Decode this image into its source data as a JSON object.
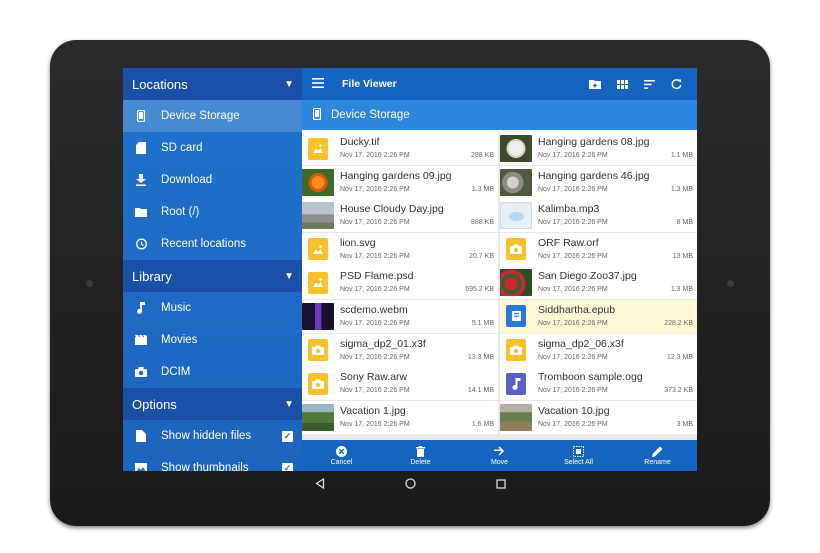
{
  "sidebar": {
    "sections": {
      "locations": "Locations",
      "library": "Library",
      "options": "Options"
    },
    "locations": [
      {
        "label": "Device Storage",
        "icon": "phone-icon"
      },
      {
        "label": "SD card",
        "icon": "sd-card-icon"
      },
      {
        "label": "Download",
        "icon": "download-icon"
      },
      {
        "label": "Root (/)",
        "icon": "folder-icon"
      },
      {
        "label": "Recent locations",
        "icon": "history-icon"
      }
    ],
    "library": [
      {
        "label": "Music",
        "icon": "music-note-icon"
      },
      {
        "label": "Movies",
        "icon": "movie-icon"
      },
      {
        "label": "DCIM",
        "icon": "camera-icon"
      }
    ],
    "options": [
      {
        "label": "Show hidden files",
        "checked": true
      },
      {
        "label": "Show thumbnails",
        "checked": true
      }
    ]
  },
  "topbar": {
    "title": "File Viewer"
  },
  "path": {
    "label": "Device Storage"
  },
  "files_left": [
    {
      "name": "Ducky.tif",
      "date": "Nov 17, 2016 2:26 PM",
      "size": "288 KB",
      "thumb": "image-icon"
    },
    {
      "name": "Hanging gardens 09.jpg",
      "date": "Nov 17, 2016 2:26 PM",
      "size": "1.3 MB",
      "thumb": "photo-flower-orange"
    },
    {
      "name": "House Cloudy Day.jpg",
      "date": "Nov 17, 2016 2:26 PM",
      "size": "888 KB",
      "thumb": "photo-house"
    },
    {
      "name": "lion.svg",
      "date": "Nov 17, 2016 2:26 PM",
      "size": "20.7 KB",
      "thumb": "image-icon"
    },
    {
      "name": "PSD Flame.psd",
      "date": "Nov 17, 2016 2:26 PM",
      "size": "695.2 KB",
      "thumb": "image-icon"
    },
    {
      "name": "scdemo.webm",
      "date": "Nov 17, 2016 2:26 PM",
      "size": "5.1 MB",
      "thumb": "video-thumb"
    },
    {
      "name": "sigma_dp2_01.x3f",
      "date": "Nov 17, 2016 2:26 PM",
      "size": "13.3 MB",
      "thumb": "camera-file-icon"
    },
    {
      "name": "Sony Raw.arw",
      "date": "Nov 17, 2016 2:26 PM",
      "size": "14.1 MB",
      "thumb": "camera-file-icon"
    },
    {
      "name": "Vacation 1.jpg",
      "date": "Nov 17, 2016 2:26 PM",
      "size": "1.6 MB",
      "thumb": "photo-vacation"
    }
  ],
  "files_right": [
    {
      "name": "Hanging gardens 08.jpg",
      "date": "Nov 17, 2016 2:26 PM",
      "size": "1.1 MB",
      "thumb": "photo-flower-white"
    },
    {
      "name": "Hanging gardens 46.jpg",
      "date": "Nov 17, 2016 2:26 PM",
      "size": "1.3 MB",
      "thumb": "photo-garden"
    },
    {
      "name": "Kalimba.mp3",
      "date": "Nov 17, 2016 2:26 PM",
      "size": "8 MB",
      "thumb": "album-art"
    },
    {
      "name": "ORF Raw.orf",
      "date": "Nov 17, 2016 2:26 PM",
      "size": "13 MB",
      "thumb": "camera-file-icon"
    },
    {
      "name": "San Diego Zoo37.jpg",
      "date": "Nov 17, 2016 2:26 PM",
      "size": "1.3 MB",
      "thumb": "photo-red-flower"
    },
    {
      "name": "Siddhartha.epub",
      "date": "Nov 17, 2016 2:26 PM",
      "size": "228.2 KB",
      "thumb": "book-icon",
      "selected": true
    },
    {
      "name": "sigma_dp2_06.x3f",
      "date": "Nov 17, 2016 2:26 PM",
      "size": "12.3 MB",
      "thumb": "camera-file-icon"
    },
    {
      "name": "Tromboon sample.ogg",
      "date": "Nov 17, 2016 2:26 PM",
      "size": "373.2 KB",
      "thumb": "music-file-icon"
    },
    {
      "name": "Vacation 10.jpg",
      "date": "Nov 17, 2016 2:26 PM",
      "size": "3 MB",
      "thumb": "photo-vacation2"
    }
  ],
  "bottombar": {
    "cancel": "Cancel",
    "delete": "Delete",
    "move": "Move",
    "select_all": "Select All",
    "rename": "Rename"
  },
  "colors": {
    "sidebar": "#1e6ed0",
    "topbar": "#1565c0",
    "pathbar": "#2e86de",
    "selected_row": "#fff8d6"
  }
}
